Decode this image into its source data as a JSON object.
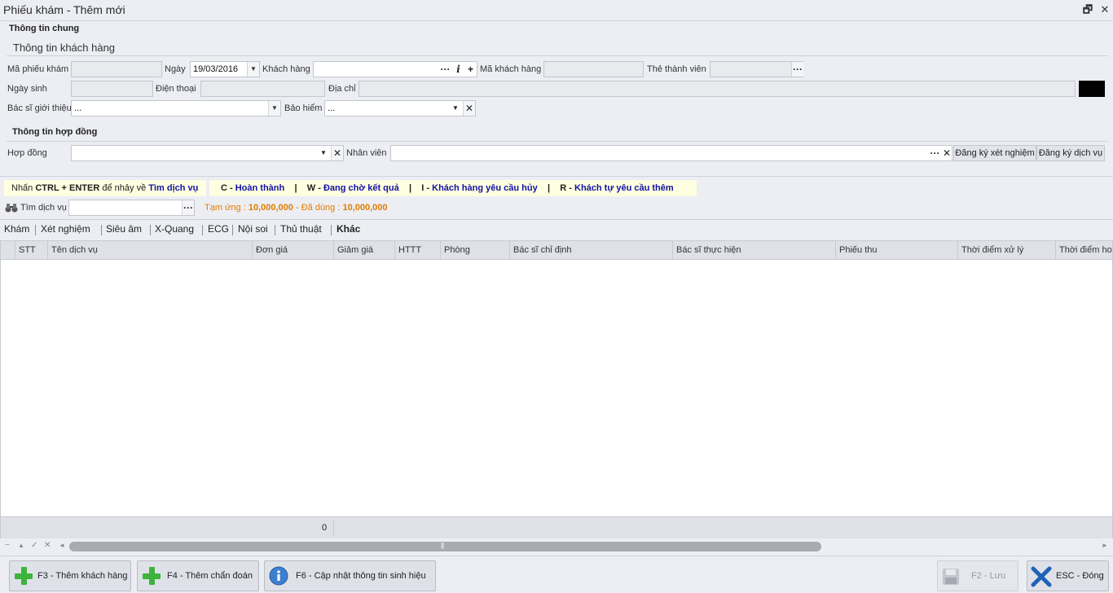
{
  "window": {
    "title": "Phiếu khám - Thêm mới",
    "restore_glyph": "🗗",
    "close_glyph": "✕"
  },
  "general": {
    "section_title": "Thông tin chung",
    "customer_subtitle": "Thông tin khách hàng"
  },
  "customer": {
    "ticket_code_label": "Mã phiếu khám",
    "ticket_code_value": "",
    "date_label": "Ngày",
    "date_value": "19/03/2016",
    "customer_label": "Khách hàng",
    "customer_value": "",
    "customer_code_label": "Mã khách hàng",
    "customer_code_value": "",
    "member_card_label": "Thẻ thành viên",
    "member_card_value": "",
    "dob_label": "Ngày sinh",
    "dob_value": "",
    "phone_label": "Điện thoại",
    "phone_value": "",
    "address_label": "Địa chỉ",
    "address_value": "",
    "referring_doctor_label": "Bác sĩ giới thiệu",
    "referring_doctor_value": "...",
    "insurance_label": "Bảo hiểm",
    "insurance_value": "..."
  },
  "contract": {
    "section_title": "Thông tin hợp đồng",
    "contract_label": "Hợp đồng",
    "contract_value": "",
    "staff_label": "Nhân viên",
    "staff_value": "",
    "register_test_label": "Đăng ký xét nghiệm",
    "register_service_label": "Đăng ký dịch vụ"
  },
  "legend": {
    "hint_prefix": "Nhấn ",
    "hint_keys": "CTRL + ENTER",
    "hint_middle": " để nhảy về ",
    "hint_target": "Tìm dịch vụ",
    "c_key": "C",
    "c_text": "Hoàn thành",
    "w_key": "W",
    "w_text": "Đang chờ kết quả",
    "i_key": "I",
    "i_text": "Khách hàng yêu cầu hủy",
    "r_key": "R",
    "r_text": "Khách tự yêu cầu thêm",
    "sep": "|",
    "dash": " - "
  },
  "search": {
    "label": "Tìm dịch vụ",
    "value": "",
    "advance_label": "Tạm ứng :",
    "advance_value": "10,000,000",
    "used_label": "Đã dùng :",
    "used_value": "10,000,000",
    "between": " - "
  },
  "tabs": [
    {
      "label": "Khám"
    },
    {
      "label": "Xét nghiệm"
    },
    {
      "label": "Siêu âm"
    },
    {
      "label": "X-Quang"
    },
    {
      "label": "ECG"
    },
    {
      "label": "Nội soi"
    },
    {
      "label": "Thủ thuật"
    },
    {
      "label": "Khác"
    }
  ],
  "grid": {
    "columns": [
      "STT",
      "Tên dịch vụ",
      "Đơn giá",
      "Giảm giá",
      "HTTT",
      "Phòng",
      "Bác sĩ chỉ định",
      "Bác sĩ thực hiện",
      "Phiếu thu",
      "Thời điểm xử lý",
      "Thời điểm hoà"
    ],
    "rows": [],
    "footer_total": "0"
  },
  "navigator": {
    "first": "−",
    "up": "▲",
    "check": "✓",
    "clear": "✕",
    "left": "◄",
    "right": "►",
    "thumb": "|||"
  },
  "buttons": {
    "add_customer": "F3 - Thêm khách hàng",
    "add_diagnosis": "F4 - Thêm chẩn đoán",
    "update_vitals": "F6 - Cập nhật thông tin sinh hiệu",
    "save": "F2 - Lưu",
    "close": "ESC - Đóng"
  },
  "glyphs": {
    "ellipsis": "···",
    "info": "i",
    "plus": "+",
    "clear": "✕",
    "dropdown": "▼"
  },
  "colors": {
    "accent_blue": "#1212a3",
    "amount_orange": "#e07c00",
    "legend_bg": "#fefee0",
    "add_green": "#3db33d",
    "close_blue": "#1f63b8"
  }
}
